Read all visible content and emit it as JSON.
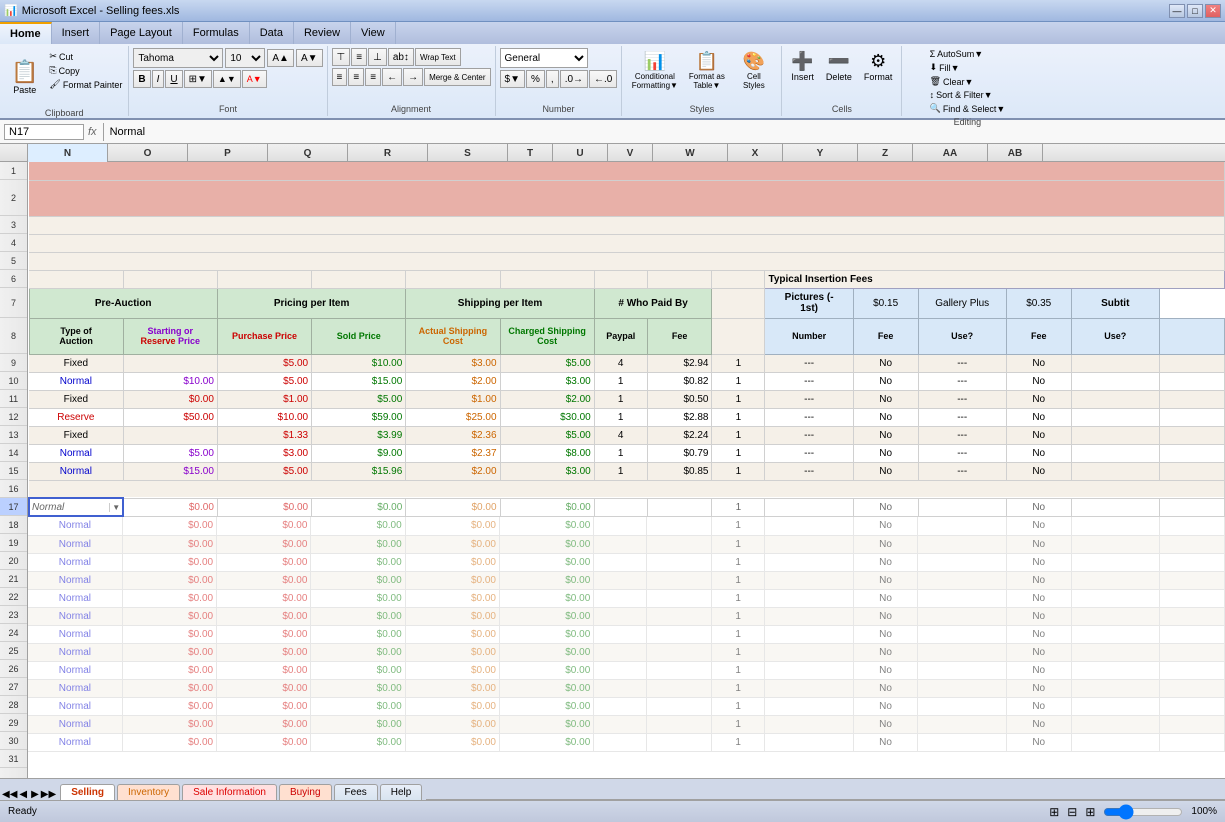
{
  "titlebar": {
    "title": "Microsoft Excel - Selling fees.xls",
    "app_icon": "📊",
    "btns": [
      "—",
      "□",
      "✕"
    ]
  },
  "ribbon": {
    "tabs": [
      "Home",
      "Insert",
      "Page Layout",
      "Formulas",
      "Data",
      "Review",
      "View"
    ],
    "active_tab": "Home",
    "groups": {
      "clipboard": {
        "label": "Clipboard",
        "paste": "Paste",
        "cut": "Cut",
        "copy": "Copy",
        "format_painter": "Format Painter"
      },
      "font": {
        "label": "Font",
        "font_name": "Tahoma",
        "font_size": "10",
        "bold": "B",
        "italic": "I",
        "underline": "U"
      },
      "alignment": {
        "label": "Alignment",
        "wrap_text": "Wrap Text",
        "merge_center": "Merge & Center"
      },
      "number": {
        "label": "Number",
        "format": "General"
      },
      "styles": {
        "label": "Styles",
        "conditional_formatting": "Conditional Formatting▼",
        "format_as_table": "Format as Table▼",
        "cell_styles": "Cell Styles"
      },
      "cells": {
        "label": "Cells",
        "insert": "Insert",
        "delete": "Delete",
        "format": "Format"
      },
      "editing": {
        "label": "Editing",
        "autosum": "AutoSum▼",
        "fill": "Fill▼",
        "clear": "Clear▼",
        "sort_filter": "Sort & Filter▼",
        "find_select": "Find & Select▼"
      }
    }
  },
  "formula_bar": {
    "name_box": "N17",
    "formula": "Normal"
  },
  "columns": [
    "N",
    "O",
    "P",
    "Q",
    "R",
    "S",
    "T",
    "U",
    "V",
    "W",
    "X",
    "Y",
    "Z",
    "AA",
    "AB"
  ],
  "rows": [
    {
      "num": 1,
      "cells": {
        "n": "",
        "o": "",
        "p": "",
        "q": "",
        "r": "",
        "s": "",
        "t": "",
        "u": "",
        "v": "",
        "w": "",
        "x": "",
        "y": "",
        "z": "",
        "aa": "",
        "ab": ""
      }
    },
    {
      "num": 2,
      "cells": {
        "n": "",
        "o": "",
        "p": "",
        "q": "",
        "r": "",
        "s": "",
        "t": "",
        "u": "",
        "v": "",
        "w": "",
        "x": "",
        "y": "",
        "z": "",
        "aa": "",
        "ab": ""
      }
    },
    {
      "num": 3,
      "cells": {}
    },
    {
      "num": 4,
      "cells": {}
    },
    {
      "num": 5,
      "cells": {}
    },
    {
      "num": 6,
      "cells": {
        "w": "Typical Insertion Fees"
      }
    },
    {
      "num": 7,
      "cells": {
        "n": "Pre-Auction",
        "p": "Pricing per Item",
        "r": "Shipping per Item",
        "t": "# Who Paid By",
        "w": "Pictures (-\n1st)",
        "x": "$0.15",
        "y": "Gallery Plus",
        "z": "$0.35",
        "aa": "Subtit"
      }
    },
    {
      "num": 8,
      "cells": {
        "n": "Type of\nAuction",
        "o": "Starting or\nReserve Price",
        "p": "Purchase Price",
        "q": "Sold Price",
        "r": "Actual Shipping\nCost",
        "s": "Charged Shipping\nCost",
        "t": "Paypal",
        "u": "Fee",
        "v": "",
        "w": "Number",
        "x": "Fee",
        "y": "Use?",
        "z": "Fee",
        "aa": "Use?",
        "ab": ""
      }
    },
    {
      "num": 9,
      "cells": {
        "n": "Fixed",
        "o": "",
        "p": "$5.00",
        "q": "$10.00",
        "r": "$3.00",
        "s": "$5.00",
        "t": "4",
        "u": "$2.94",
        "v": "1",
        "w": "---",
        "x": "No",
        "y": "---",
        "z": "No",
        "aa": "",
        "ab": ""
      }
    },
    {
      "num": 10,
      "cells": {
        "n": "Normal",
        "o": "$10.00",
        "p": "$5.00",
        "q": "$15.00",
        "r": "$2.00",
        "s": "$3.00",
        "t": "1",
        "u": "$0.82",
        "v": "1",
        "w": "---",
        "x": "No",
        "y": "---",
        "z": "No",
        "aa": "",
        "ab": ""
      }
    },
    {
      "num": 11,
      "cells": {
        "n": "Fixed",
        "o": "$0.00",
        "p": "$1.00",
        "q": "$5.00",
        "r": "$1.00",
        "s": "$2.00",
        "t": "1",
        "u": "$0.50",
        "v": "1",
        "w": "---",
        "x": "No",
        "y": "---",
        "z": "No",
        "aa": "",
        "ab": ""
      }
    },
    {
      "num": 12,
      "cells": {
        "n": "Reserve",
        "o": "$50.00",
        "p": "$10.00",
        "q": "$59.00",
        "r": "$25.00",
        "s": "$30.00",
        "t": "1",
        "u": "$2.88",
        "v": "1",
        "w": "---",
        "x": "No",
        "y": "---",
        "z": "No",
        "aa": "",
        "ab": ""
      }
    },
    {
      "num": 13,
      "cells": {
        "n": "Fixed",
        "o": "",
        "p": "$1.33",
        "q": "$3.99",
        "r": "$2.36",
        "s": "$5.00",
        "t": "4",
        "u": "$2.24",
        "v": "1",
        "w": "---",
        "x": "No",
        "y": "---",
        "z": "No",
        "aa": "",
        "ab": ""
      }
    },
    {
      "num": 14,
      "cells": {
        "n": "Normal",
        "o": "$5.00",
        "p": "$3.00",
        "q": "$9.00",
        "r": "$2.37",
        "s": "$8.00",
        "t": "1",
        "u": "$0.79",
        "v": "1",
        "w": "---",
        "x": "No",
        "y": "---",
        "z": "No",
        "aa": "",
        "ab": ""
      }
    },
    {
      "num": 15,
      "cells": {
        "n": "Normal",
        "o": "$15.00",
        "p": "$5.00",
        "q": "$15.96",
        "r": "$2.00",
        "s": "$3.00",
        "t": "1",
        "u": "$0.85",
        "v": "1",
        "w": "---",
        "x": "No",
        "y": "---",
        "z": "No",
        "aa": "",
        "ab": ""
      }
    },
    {
      "num": 16,
      "cells": {}
    },
    {
      "num": 17,
      "cells": {
        "n": "dropdown",
        "o": "$0.00",
        "p": "$0.00",
        "q": "$0.00",
        "r": "$0.00",
        "s": "$0.00",
        "t": "",
        "u": "",
        "v": "1",
        "w": "",
        "x": "No",
        "y": "",
        "z": "No",
        "aa": "",
        "ab": ""
      }
    },
    {
      "num": 18,
      "cells": {
        "n": "Normal",
        "o": "$0.00",
        "p": "$0.00",
        "q": "$0.00",
        "r": "$0.00",
        "s": "$0.00",
        "t": "",
        "u": "",
        "v": "1",
        "w": "",
        "x": "No",
        "y": "",
        "z": "No",
        "aa": "",
        "ab": ""
      }
    },
    {
      "num": 19,
      "cells": {
        "n": "Normal",
        "o": "$0.00",
        "p": "$0.00",
        "q": "$0.00",
        "r": "$0.00",
        "s": "$0.00",
        "t": "",
        "u": "",
        "v": "1",
        "w": "",
        "x": "No",
        "y": "",
        "z": "No",
        "aa": "",
        "ab": ""
      }
    },
    {
      "num": 20,
      "cells": {
        "n": "Normal",
        "o": "$0.00",
        "p": "$0.00",
        "q": "$0.00",
        "r": "$0.00",
        "s": "$0.00",
        "t": "",
        "u": "",
        "v": "1",
        "w": "",
        "x": "No",
        "y": "",
        "z": "No",
        "aa": "",
        "ab": ""
      }
    },
    {
      "num": 21,
      "cells": {
        "n": "Normal",
        "o": "$0.00",
        "p": "$0.00",
        "q": "$0.00",
        "r": "$0.00",
        "s": "$0.00",
        "t": "",
        "u": "",
        "v": "1",
        "w": "",
        "x": "No",
        "y": "",
        "z": "No",
        "aa": "",
        "ab": ""
      }
    },
    {
      "num": 22,
      "cells": {
        "n": "Normal",
        "o": "$0.00",
        "p": "$0.00",
        "q": "$0.00",
        "r": "$0.00",
        "s": "$0.00",
        "t": "",
        "u": "",
        "v": "1",
        "w": "",
        "x": "No",
        "y": "",
        "z": "No",
        "aa": "",
        "ab": ""
      }
    },
    {
      "num": 23,
      "cells": {
        "n": "Normal",
        "o": "$0.00",
        "p": "$0.00",
        "q": "$0.00",
        "r": "$0.00",
        "s": "$0.00",
        "t": "",
        "u": "",
        "v": "1",
        "w": "",
        "x": "No",
        "y": "",
        "z": "No",
        "aa": "",
        "ab": ""
      }
    },
    {
      "num": 24,
      "cells": {
        "n": "Normal",
        "o": "$0.00",
        "p": "$0.00",
        "q": "$0.00",
        "r": "$0.00",
        "s": "$0.00",
        "t": "",
        "u": "",
        "v": "1",
        "w": "",
        "x": "No",
        "y": "",
        "z": "No",
        "aa": "",
        "ab": ""
      }
    },
    {
      "num": 25,
      "cells": {
        "n": "Normal",
        "o": "$0.00",
        "p": "$0.00",
        "q": "$0.00",
        "r": "$0.00",
        "s": "$0.00",
        "t": "",
        "u": "",
        "v": "1",
        "w": "",
        "x": "No",
        "y": "",
        "z": "No",
        "aa": "",
        "ab": ""
      }
    },
    {
      "num": 26,
      "cells": {
        "n": "Normal",
        "o": "$0.00",
        "p": "$0.00",
        "q": "$0.00",
        "r": "$0.00",
        "s": "$0.00",
        "t": "",
        "u": "",
        "v": "1",
        "w": "",
        "x": "No",
        "y": "",
        "z": "No",
        "aa": "",
        "ab": ""
      }
    },
    {
      "num": 27,
      "cells": {
        "n": "Normal",
        "o": "$0.00",
        "p": "$0.00",
        "q": "$0.00",
        "r": "$0.00",
        "s": "$0.00",
        "t": "",
        "u": "",
        "v": "1",
        "w": "",
        "x": "No",
        "y": "",
        "z": "No",
        "aa": "",
        "ab": ""
      }
    },
    {
      "num": 28,
      "cells": {
        "n": "Normal",
        "o": "$0.00",
        "p": "$0.00",
        "q": "$0.00",
        "r": "$0.00",
        "s": "$0.00",
        "t": "",
        "u": "",
        "v": "1",
        "w": "",
        "x": "No",
        "y": "",
        "z": "No",
        "aa": "",
        "ab": ""
      }
    },
    {
      "num": 29,
      "cells": {
        "n": "Normal",
        "o": "$0.00",
        "p": "$0.00",
        "q": "$0.00",
        "r": "$0.00",
        "s": "$0.00",
        "t": "",
        "u": "",
        "v": "1",
        "w": "",
        "x": "No",
        "y": "",
        "z": "No",
        "aa": "",
        "ab": ""
      }
    },
    {
      "num": 30,
      "cells": {
        "n": "Normal",
        "o": "$0.00",
        "p": "$0.00",
        "q": "$0.00",
        "r": "$0.00",
        "s": "$0.00",
        "t": "",
        "u": "",
        "v": "1",
        "w": "",
        "x": "No",
        "y": "",
        "z": "No",
        "aa": "",
        "ab": ""
      }
    },
    {
      "num": 31,
      "cells": {}
    }
  ],
  "sheet_tabs": [
    {
      "label": "Selling",
      "active": true,
      "color": "selling"
    },
    {
      "label": "Inventory",
      "active": false,
      "color": "inventory"
    },
    {
      "label": "Sale Information",
      "active": false,
      "color": "sale"
    },
    {
      "label": "Buying",
      "active": false,
      "color": "buying"
    },
    {
      "label": "Fees",
      "active": false,
      "color": "normal"
    },
    {
      "label": "Help",
      "active": false,
      "color": "normal"
    }
  ],
  "status": {
    "left": "Ready",
    "zoom": "100%"
  }
}
